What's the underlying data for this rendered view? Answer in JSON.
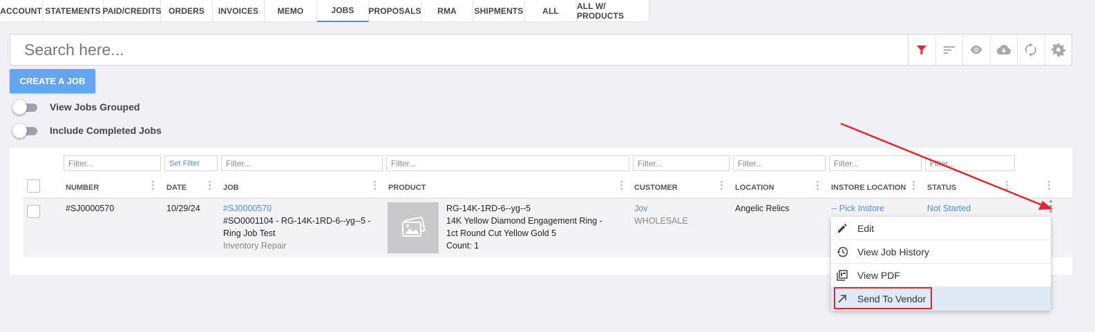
{
  "tabs": [
    {
      "label": "ACCOUNT"
    },
    {
      "label": "STATEMENTS"
    },
    {
      "label": "PAID/CREDITS"
    },
    {
      "label": "ORDERS"
    },
    {
      "label": "INVOICES"
    },
    {
      "label": "MEMO"
    },
    {
      "label": "JOBS",
      "active": true
    },
    {
      "label": "PROPOSALS"
    },
    {
      "label": "RMA"
    },
    {
      "label": "SHIPMENTS"
    },
    {
      "label": "ALL"
    },
    {
      "label": "ALL W/ PRODUCTS"
    }
  ],
  "search": {
    "placeholder": "Search here..."
  },
  "toolbar": {
    "icons": [
      "filter-icon",
      "sort-icon",
      "eye-icon",
      "cloud-download-icon",
      "refresh-icon",
      "gear-icon"
    ],
    "filter_color": "#e5242c"
  },
  "create_button": "CREATE A JOB",
  "toggles": {
    "grouped": "View Jobs Grouped",
    "completed": "Include Completed Jobs"
  },
  "filters": {
    "number": "Filter...",
    "date": "Set Filter",
    "job": "Filter...",
    "product": "Filter...",
    "customer": "Filter...",
    "location": "Filter...",
    "instore": "Filter...",
    "status": "Filter..."
  },
  "columns": {
    "number": "NUMBER",
    "date": "DATE",
    "job": "JOB",
    "product": "PRODUCT",
    "customer": "CUSTOMER",
    "location": "LOCATION",
    "instore": "INSTORE LOCATION",
    "status": "STATUS"
  },
  "row": {
    "number": "#SJ0000570",
    "date": "10/29/24",
    "job_link": "#SJ0000570",
    "job_line1": "#SO0001104 - RG-14K-1RD-6--yg--5 -",
    "job_line2": "Ring Job Test",
    "job_type": "Inventory Repair",
    "product_sku": "RG-14K-1RD-6--yg--5",
    "product_line1": "14K Yellow Diamond Engagement Ring -",
    "product_line2": "1ct Round Cut Yellow Gold 5",
    "product_count": "Count: 1",
    "customer": "Jov",
    "customer_type": "WHOLESALE",
    "location": "Angelic Relics",
    "instore": "-- Pick Instore",
    "status": "Not Started"
  },
  "menu": [
    {
      "label": "Edit",
      "icon": "pencil-icon"
    },
    {
      "label": "View Job History",
      "icon": "history-icon"
    },
    {
      "label": "View PDF",
      "icon": "pdf-icon"
    },
    {
      "label": "Send To Vendor",
      "icon": "arrow-up-right-icon",
      "highlighted": true
    }
  ],
  "annotation_color": "#e5242c"
}
